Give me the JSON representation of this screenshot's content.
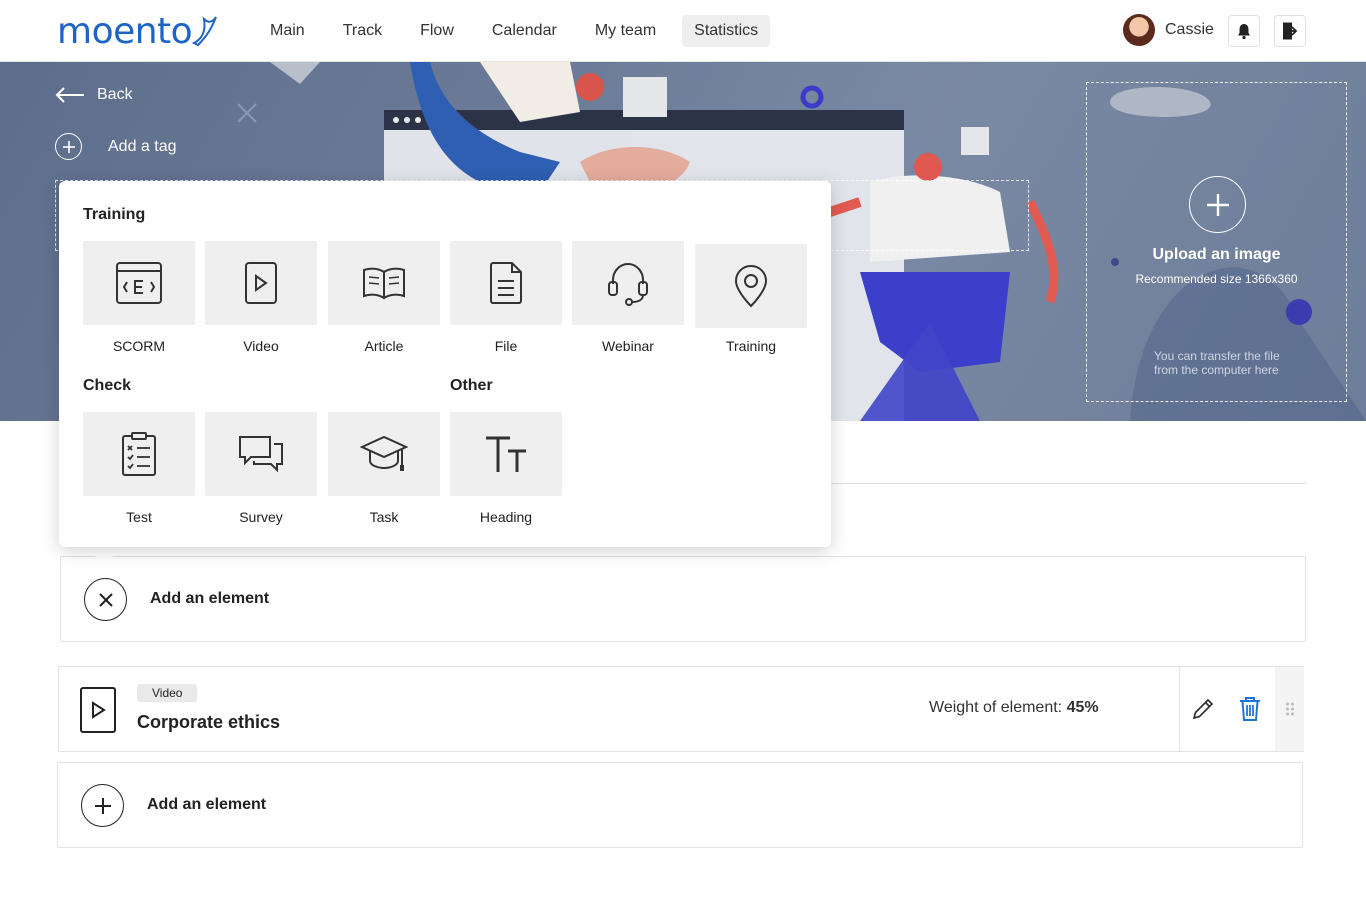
{
  "header": {
    "logo": "moento",
    "nav": [
      {
        "label": "Main",
        "active": false
      },
      {
        "label": "Track",
        "active": false
      },
      {
        "label": "Flow",
        "active": false
      },
      {
        "label": "Calendar",
        "active": false
      },
      {
        "label": "My team",
        "active": false
      },
      {
        "label": "Statistics",
        "active": true
      }
    ],
    "user_name": "Cassie",
    "icons": [
      "bell-icon",
      "logout-icon"
    ]
  },
  "hero": {
    "back_label": "Back",
    "add_tag_label": "Add a tag",
    "upload_title": "Upload an image",
    "upload_subtitle": "Recommended size 1366x360",
    "upload_hint": "You can transfer the file from the computer here"
  },
  "popover": {
    "sections": {
      "training": "Training",
      "check": "Check",
      "other": "Other"
    },
    "training_items": [
      {
        "label": "SCORM",
        "icon": "scorm-icon"
      },
      {
        "label": "Video",
        "icon": "video-icon"
      },
      {
        "label": "Article",
        "icon": "book-icon"
      },
      {
        "label": "File",
        "icon": "file-icon"
      },
      {
        "label": "Webinar",
        "icon": "headset-icon"
      },
      {
        "label": "Training",
        "icon": "location-pin-icon"
      }
    ],
    "check_items": [
      {
        "label": "Test",
        "icon": "checklist-icon"
      },
      {
        "label": "Survey",
        "icon": "chat-bubbles-icon"
      },
      {
        "label": "Task",
        "icon": "graduation-cap-icon"
      }
    ],
    "other_items": [
      {
        "label": "Heading",
        "icon": "text-heading-icon"
      }
    ]
  },
  "add_element_open": {
    "label": "Add an element"
  },
  "element": {
    "type_badge": "Video",
    "title": "Corporate ethics",
    "weight_label": "Weight of element:",
    "weight_value": "45%",
    "colors": {
      "delete": "#1e73d8"
    }
  },
  "add_element_bottom": {
    "label": "Add an element"
  }
}
